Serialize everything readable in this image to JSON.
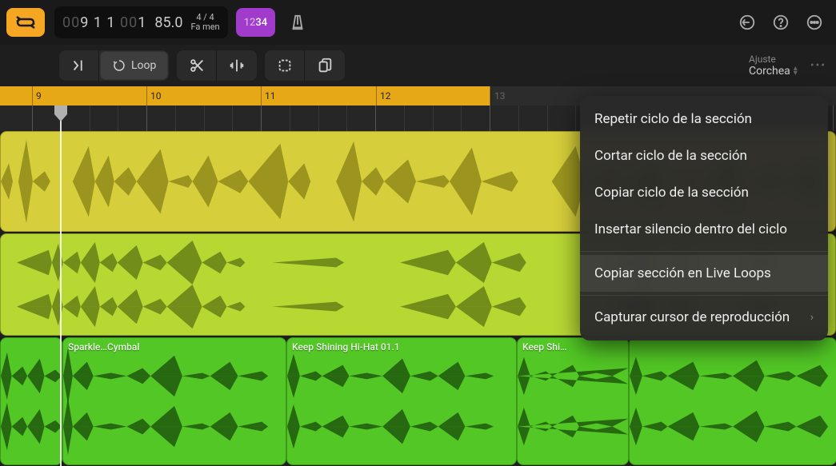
{
  "transport": {
    "position_dim1": "00",
    "position_main": "9 1",
    "position_mid": "1",
    "position_dim2": "00",
    "position_end": "1",
    "tempo": "85.0",
    "timesig": "4 / 4",
    "key": "Fa men",
    "countin_dim": "12",
    "countin_bright": "34"
  },
  "toolbar": {
    "loop_label": "Loop"
  },
  "snap": {
    "label": "Ajuste",
    "value": "Corchea"
  },
  "ruler": {
    "ticks": [
      "9",
      "10",
      "11",
      "12",
      "13"
    ]
  },
  "regions": {
    "green1": "Sparkle…Cymbal",
    "green2": "Keep Shining Hi-Hat 01.1",
    "green3": "Keep Shi…"
  },
  "menu": {
    "items": [
      "Repetir ciclo de la sección",
      "Cortar ciclo de la sección",
      "Copiar ciclo de la sección",
      "Insertar silencio dentro del ciclo",
      "Copiar sección en Live Loops",
      "Capturar cursor de reproducción"
    ]
  }
}
